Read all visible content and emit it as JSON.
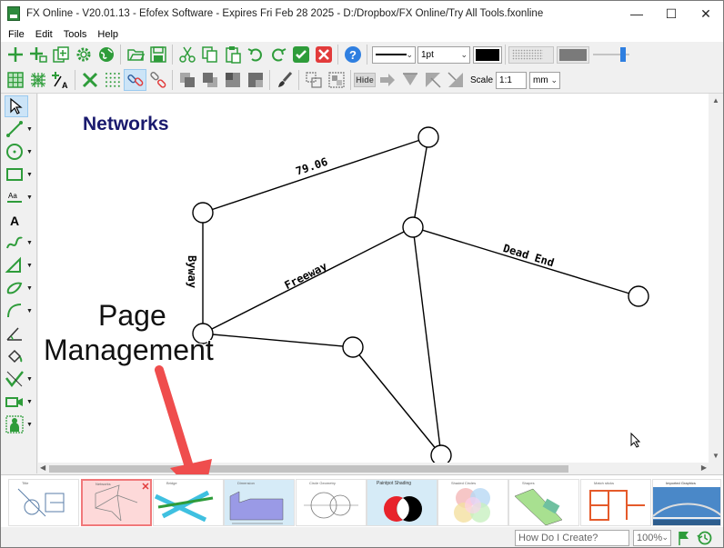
{
  "window": {
    "title": "FX Online - V20.01.13 - Efofex Software - Expires Fri Feb 28 2025 - D:/Dropbox/FX Online/Try All Tools.fxonline",
    "minimize": "—",
    "maximize": "☐",
    "close": "✕"
  },
  "menu": {
    "items": [
      {
        "label": "File"
      },
      {
        "label": "Edit"
      },
      {
        "label": "Tools"
      },
      {
        "label": "Help"
      }
    ]
  },
  "toolbar": {
    "line_width": "1pt",
    "scale_label": "Scale",
    "scale_value": "1:1",
    "unit_value": "mm",
    "hide_label": "Hide"
  },
  "canvas": {
    "heading": "Networks",
    "edge_labels": {
      "top": "79.06",
      "left": "Byway",
      "middle": "Freeway",
      "right": "Dead End"
    }
  },
  "annotation": {
    "line1": "Page",
    "line2": "Management",
    "arrow_color": "#ef4d4d"
  },
  "page_thumbnails": [
    {
      "title": "Title"
    },
    {
      "title": "Networks"
    },
    {
      "title": "Bridge"
    },
    {
      "title": "Dimension"
    },
    {
      "title": "Circle Geometry"
    },
    {
      "title": "Paintpot Shading"
    },
    {
      "title": "Shaded Circles"
    },
    {
      "title": "Shapes"
    },
    {
      "title": "Match sticks"
    },
    {
      "title": "Imported Graphics"
    }
  ],
  "status": {
    "search_placeholder": "How Do I Create?",
    "zoom": "100%"
  },
  "colors": {
    "heading": "#1a1a6e",
    "accent_green": "#2e9c3a",
    "accent_red": "#e23b3b",
    "accent_blue": "#2f7fe0",
    "selected_page_bg": "#fdd9d9"
  }
}
